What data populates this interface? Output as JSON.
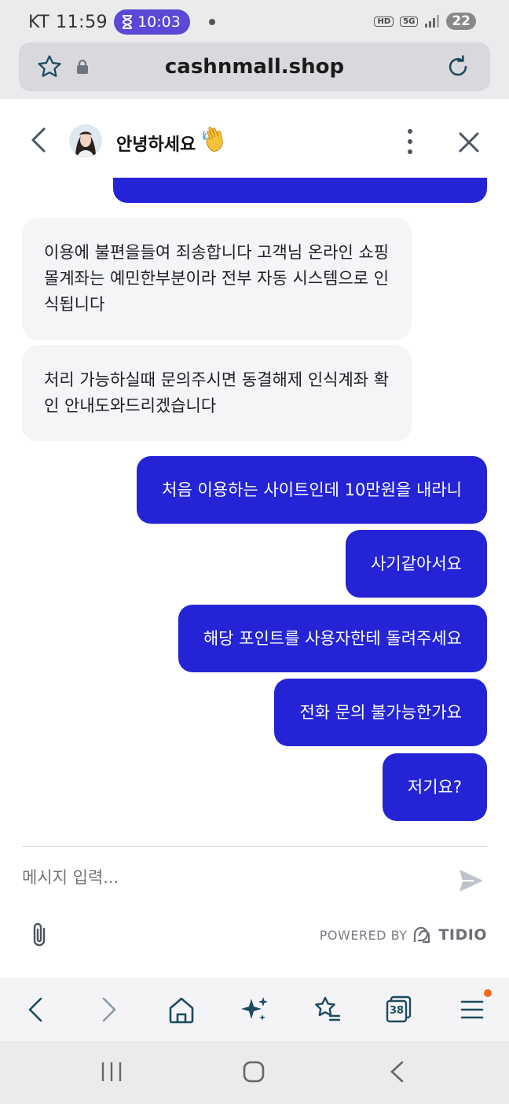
{
  "status_bar": {
    "carrier": "KT",
    "time": "11:59",
    "timer": "10:03",
    "network_badge": "HD",
    "network_type": "5G",
    "battery": "22"
  },
  "url_bar": {
    "url": "cashnmall.shop"
  },
  "chat_header": {
    "title": "안녕하세요",
    "emoji": "👋"
  },
  "messages": [
    {
      "sender": "agent",
      "text": "이용에 불편을들여 죄송합니다 고객님 온라인 쇼핑몰계좌는 예민한부분이라 전부 자동 시스템으로 인식됩니다"
    },
    {
      "sender": "agent",
      "text": "처리 가능하실때 문의주시면 동결해제 인식계좌 확인 안내도와드리겠습니다"
    },
    {
      "sender": "user",
      "text": "처음 이용하는 사이트인데 10만원을 내라니"
    },
    {
      "sender": "user",
      "text": "사기같아서요"
    },
    {
      "sender": "user",
      "text": "해당 포인트를 사용자한테 돌려주세요"
    },
    {
      "sender": "user",
      "text": "전화 문의 불가능한가요"
    },
    {
      "sender": "user",
      "text": "저기요?"
    }
  ],
  "composer": {
    "placeholder": "메시지 입력..."
  },
  "branding": {
    "powered_by": "POWERED BY",
    "name": "TIDIO"
  },
  "browser_nav": {
    "tab_count": "38"
  },
  "colors": {
    "user_bubble": "#2424d6",
    "agent_bubble": "#f4f5f7",
    "accent_icon": "#1d4a5e",
    "timer_pill": "#5a48d6",
    "notification_dot": "#f26a1b"
  }
}
